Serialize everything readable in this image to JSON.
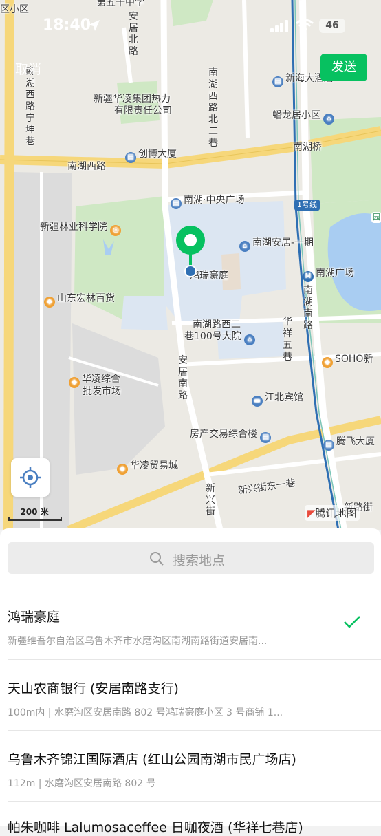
{
  "status_bar": {
    "time": "18:40",
    "battery": "46"
  },
  "nav": {
    "cancel": "取消",
    "send": "发送"
  },
  "map": {
    "labels": {
      "xiao_qu": "区小区",
      "di_wu_zhong": "第五十中学",
      "anju_bei": "安居北路",
      "nanhu_xi_bei2": "南湖西路北二巷",
      "xinhai": "新海大酒店",
      "xinjiang_hualing": "新疆华凌集团热力",
      "youxian": "有限责任公司",
      "panlong": "蟠龙居小区",
      "nanhu_xi_ning": "南湖西路宁坤巷",
      "chuangbo": "创博大厦",
      "nanhuqiao": "南湖桥",
      "nanhu_xilu": "南湖西路",
      "zhongyang": "南湖·中央广场",
      "line1": "1号线",
      "linye": "新疆林业科学院",
      "anju_yiqi": "南湖安居-一期",
      "nanhu_guangchang": "南湖广场",
      "hongrui": "鸿瑞豪庭",
      "nanhu_nan": "南湖南路",
      "shandong": "山东宏林百货",
      "yuanyuan": "园",
      "xi2_line1": "南湖路西二",
      "xi2_line2": "巷100号大院",
      "huaxiang": "华祥五巷",
      "soho": "SOHO新",
      "anju_nan": "安居南路",
      "hualing_pifa1": "华凌综合",
      "hualing_pifa2": "批发市场",
      "jiangbei": "江北宾馆",
      "fangchan": "房产交易综合楼",
      "tengfei": "腾飞大厦",
      "hualing_maoyi": "华凌贸易城",
      "xinxing_dong": "新兴街东一巷",
      "xinxing": "新兴街",
      "xinlu": "新路街"
    },
    "scale": "200 米",
    "brand": "腾讯地图"
  },
  "search": {
    "placeholder": "搜索地点"
  },
  "results": [
    {
      "title": "鸿瑞豪庭",
      "subtitle": "新疆维吾尔自治区乌鲁木齐市水磨沟区南湖南路街道安居南...",
      "selected": true
    },
    {
      "title": "天山农商银行 (安居南路支行)",
      "subtitle": "100m内 | 水磨沟区安居南路 802 号鸿瑞豪庭小区 3 号商铺 1...",
      "selected": false
    },
    {
      "title": "乌鲁木齐锦江国际酒店 (红山公园南湖市民广场店)",
      "subtitle": "112m | 水磨沟区安居南路 802 号",
      "selected": false
    },
    {
      "title": "帕朱咖啡 Lalumosaceffee 日咖夜酒 (华祥七巷店)",
      "subtitle": "",
      "selected": false
    }
  ],
  "colors": {
    "accent": "#07c160",
    "pin": "#07c160",
    "park": "#cfe8c4",
    "water": "#a9cdf2",
    "road": "#f6d77a",
    "metro": "#2f6fb3"
  },
  "icons": [
    "location-arrow-icon",
    "signal-icon",
    "wifi-icon",
    "battery-icon",
    "map-pin-icon",
    "crosshair-icon",
    "search-icon",
    "checkmark-icon",
    "tencent-map-logo-icon"
  ]
}
